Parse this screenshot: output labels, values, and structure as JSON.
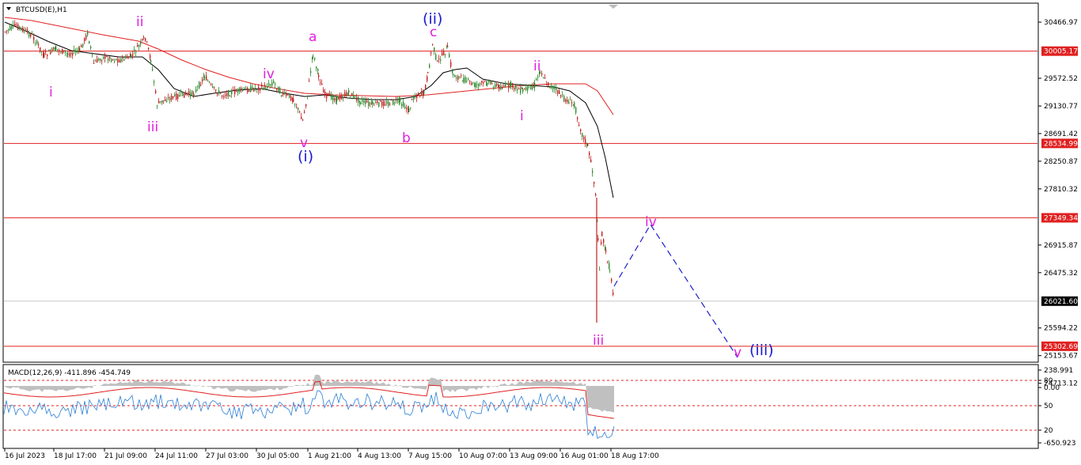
{
  "header": {
    "symbol": "BTCUSD(E),H1"
  },
  "macd": {
    "label": "MACD(12,26,9) -411.896 -454.749"
  },
  "price_scale": {
    "labels": [
      "30466.97",
      "29572.52",
      "29130.77",
      "28691.42",
      "28250.87",
      "27810.32",
      "26915.87",
      "26475.32",
      "25594.22",
      "25153.67",
      "24713.12"
    ],
    "tagged_levels": [
      {
        "value": "30005.17",
        "style": "red-line"
      },
      {
        "value": "28534.99",
        "style": "red-line"
      },
      {
        "value": "27349.34",
        "style": "red-line"
      },
      {
        "value": "26021.60",
        "style": "current"
      },
      {
        "value": "25302.69",
        "style": "red-line"
      }
    ]
  },
  "macd_scale": {
    "labels": [
      "238.991",
      "80",
      "0.00",
      "50",
      "20",
      "-650.923"
    ]
  },
  "time_axis": {
    "labels": [
      "16 Jul 2023",
      "18 Jul 17:00",
      "21 Jul 09:00",
      "24 Jul 11:00",
      "27 Jul 03:00",
      "30 Jul 05:00",
      "1 Aug 21:00",
      "4 Aug 13:00",
      "7 Aug 15:00",
      "10 Aug 07:00",
      "13 Aug 09:00",
      "16 Aug 01:00",
      "18 Aug 17:00"
    ]
  },
  "wave_labels": [
    {
      "text": "ii",
      "color": "magenta"
    },
    {
      "text": "i",
      "color": "magenta"
    },
    {
      "text": "iii",
      "color": "magenta"
    },
    {
      "text": "iv",
      "color": "magenta"
    },
    {
      "text": "v",
      "color": "magenta"
    },
    {
      "text": "(i)",
      "color": "blue"
    },
    {
      "text": "a",
      "color": "magenta"
    },
    {
      "text": "b",
      "color": "magenta"
    },
    {
      "text": "c",
      "color": "magenta"
    },
    {
      "text": "(ii)",
      "color": "blue"
    },
    {
      "text": "i",
      "color": "magenta"
    },
    {
      "text": "ii",
      "color": "magenta"
    },
    {
      "text": "iii",
      "color": "magenta"
    },
    {
      "text": "iv",
      "color": "magenta"
    },
    {
      "text": "v",
      "color": "magenta"
    },
    {
      "text": "(iii)",
      "color": "blue"
    }
  ],
  "colors": {
    "level_line": "#e02020",
    "ma_fast": "#000000",
    "ma_slow": "#e02020",
    "bull_candle": "#2e8b2e",
    "bear_candle": "#c02020",
    "wave_magenta": "#e020e0",
    "wave_blue": "#1c1cd0",
    "macd_histogram": "#c0c0c0",
    "macd_line": "#2a7fd4",
    "macd_signal": "#e02020",
    "projection": "#2020d0"
  }
}
